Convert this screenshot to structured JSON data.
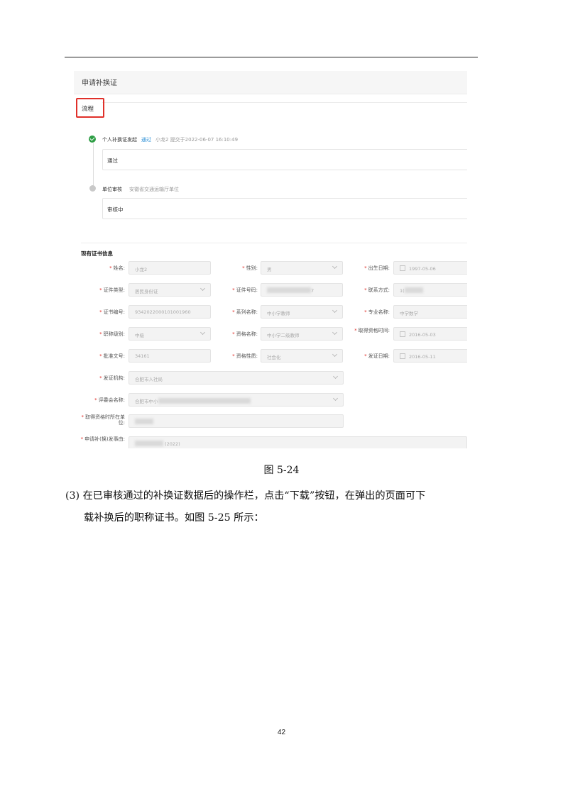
{
  "screenshot": {
    "header_title": "申请补换证",
    "flow_label": "流程",
    "timeline": [
      {
        "name": "个人补换证发起",
        "status": "通过",
        "meta": "小龙2 提交于2022-06-07 16:10:49",
        "card": "通过",
        "state": "done"
      },
      {
        "name": "单位审核",
        "org": "安徽省交通运输厅单位",
        "card": "审核中",
        "state": "pending"
      }
    ],
    "section_title": "现有证书信息",
    "fields": {
      "name": {
        "label": "姓名:",
        "value": "小龙2"
      },
      "gender": {
        "label": "性别:",
        "value": "男"
      },
      "birth": {
        "label": "出生日期:",
        "value": "1997-05-06"
      },
      "cert_type": {
        "label": "证件类型:",
        "value": "居民身份证"
      },
      "cert_no": {
        "label": "证件号码:",
        "value": "7"
      },
      "contact": {
        "label": "联系方式:",
        "value": "1("
      },
      "cert_code": {
        "label": "证书编号:",
        "value": "9342022000101001960"
      },
      "series": {
        "label": "系列名称:",
        "value": "中小学教师"
      },
      "major": {
        "label": "专业名称:",
        "value": "中学数学"
      },
      "level": {
        "label": "职称级别:",
        "value": "中级"
      },
      "qual": {
        "label": "资格名称:",
        "value": "中小学二级教师"
      },
      "qual_time": {
        "label": "取得资格时间:",
        "value": "2016-05-03"
      },
      "approval": {
        "label": "批准文号:",
        "value": "34161"
      },
      "qual_nature": {
        "label": "资格性质:",
        "value": "社会化"
      },
      "issue_date": {
        "label": "发证日期:",
        "value": "2016-05-11"
      },
      "issuer": {
        "label": "发证机构:",
        "value": "合肥市人社局"
      },
      "committee": {
        "label": "评委会名称:",
        "value": "合肥市中小"
      },
      "qual_unit": {
        "label": "取得资格时所在单位:",
        "value": ""
      },
      "apply_reason": {
        "label": "申请补(换)发事由:",
        "value": "(2022)"
      }
    }
  },
  "caption": "图 5-24",
  "paragraph": {
    "line1": "(3) 在已审核通过的补换证数据后的操作栏，点击“下载”按钮，在弹出的页面可下",
    "line2": "载补换后的职称证书。如图 5-25 所示："
  },
  "page_number": "42"
}
